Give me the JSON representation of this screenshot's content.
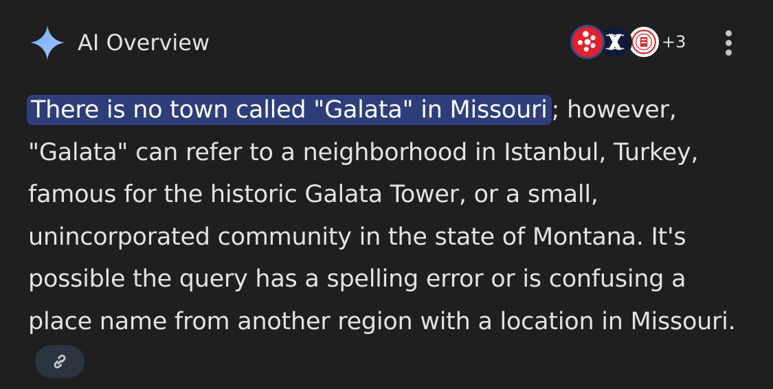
{
  "header": {
    "title": "AI Overview",
    "more_sources_label": "+3"
  },
  "sources": [
    {
      "name": "yelp",
      "icon": "yelp-icon",
      "color": "#e0222f"
    },
    {
      "name": "x-source",
      "icon": "x-logo-icon",
      "color": "#0e1a3a"
    },
    {
      "name": "emblem-source",
      "icon": "emblem-icon",
      "color": "#d32f2f"
    }
  ],
  "answer": {
    "highlighted": "There is no town called \"Galata\" in Missouri",
    "rest": "; however, \"Galata\" can refer to a neighborhood in Istanbul, Turkey, famous for the historic Galata Tower, or a small, unincorporated community in the state of Montana. It's possible the query has a spelling error or is confusing a place name from another region with a location in Missouri."
  },
  "icons": {
    "sparkle": "gemini-sparkle-icon",
    "menu": "more-vert-icon",
    "link": "link-icon"
  },
  "colors": {
    "background": "#1f1f1f",
    "highlight": "#2f3e7a",
    "sparkle": "#8ab4f8",
    "chip": "#2b3440"
  }
}
